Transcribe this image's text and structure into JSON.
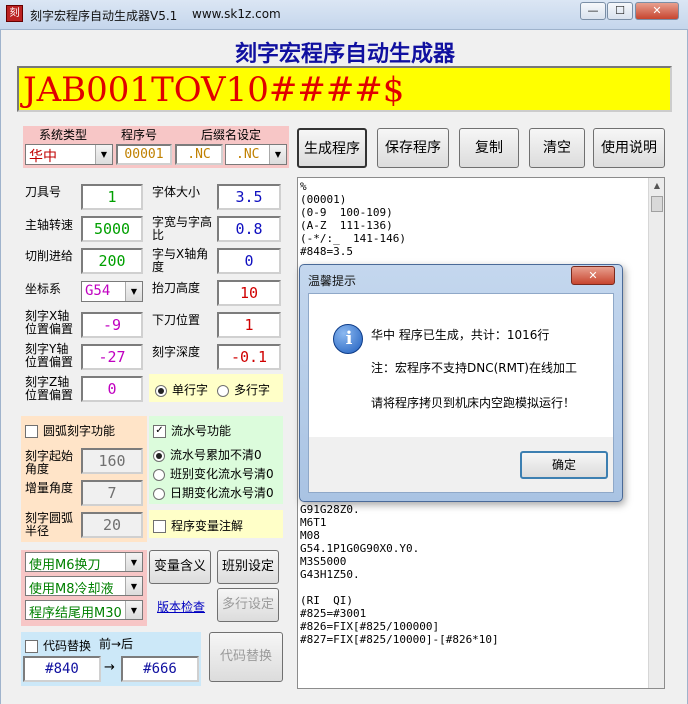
{
  "window": {
    "title": "刻字宏程序自动生成器V5.1",
    "website": "www.sk1z.com",
    "min": "—",
    "max": "☐",
    "close": "✕"
  },
  "header": {
    "title": "刻字宏程序自动生成器",
    "input_text": "JAB001TOV10####$"
  },
  "settings": {
    "system_label": "系统类型",
    "program_no_label": "程序号",
    "suffix_label": "后缀名设定",
    "system_value": "华中",
    "program_no_value": "00001",
    "suffix_value1": ".NC",
    "suffix_value2": ".NC"
  },
  "params": {
    "tool_no_label": "刀具号",
    "tool_no": "1",
    "font_size_label": "字体大小",
    "font_size": "3.5",
    "spindle_label": "主轴转速",
    "spindle": "5000",
    "ratio_label": "字宽与字高比",
    "ratio": "0.8",
    "feed_label": "切削进给",
    "feed": "200",
    "angle_label": "字与X轴角度",
    "angle": "0",
    "coord_label": "坐标系",
    "coord": "G54",
    "lift_label": "抬刀高度",
    "lift": "10",
    "x_offset_label": "刻字X轴位置偏置",
    "x_offset": "-9",
    "down_label": "下刀位置",
    "down": "1",
    "y_offset_label": "刻字Y轴位置偏置",
    "y_offset": "-27",
    "depth_label": "刻字深度",
    "depth": "-0.1",
    "z_offset_label": "刻字Z轴位置偏置",
    "z_offset": "0",
    "single_line": "单行字",
    "multi_line": "多行字"
  },
  "arc": {
    "checkbox_label": "圆弧刻字功能",
    "start_angle_label": "刻字起始角度",
    "start_angle": "160",
    "increment_label": "增量角度",
    "increment": "7",
    "radius_label": "刻字圆弧半径",
    "radius": "20"
  },
  "serial": {
    "checkbox_label": "流水号功能",
    "opt1": "流水号累加不清0",
    "opt2": "班别变化流水号清0",
    "opt3": "日期变化流水号清0",
    "var_annotation": "程序变量注解"
  },
  "combos": {
    "m6": "使用M6换刀",
    "m8": "使用M8冷却液",
    "m30": "程序结尾用M30"
  },
  "buttons": {
    "var_meaning": "变量含义",
    "shift_setting": "班别设定",
    "version_check": "版本检查",
    "multi_setting": "多行设定",
    "generate": "生成程序",
    "save": "保存程序",
    "copy": "复制",
    "clear": "清空",
    "help": "使用说明",
    "code_replace": "代码替换"
  },
  "replace": {
    "checkbox_label": "代码替换",
    "hint": "前→后",
    "from": "#840",
    "to": "#666",
    "arrow": "→"
  },
  "code_lines_top": [
    "%",
    "(00001)",
    "(0-9  100-109)",
    "(A-Z  111-136)",
    "(-*/:_  141-146)",
    "#848=3.5"
  ],
  "code_lines_bottom": [
    "G91G28Z0.",
    "M6T1",
    "M08",
    "G54.1P1G0G90X0.Y0.",
    "M3S5000",
    "G43H1Z50.",
    "",
    "(RI  QI)",
    "#825=#3001",
    "#826=FIX[#825/100000]",
    "#827=FIX[#825/10000]-[#826*10]"
  ],
  "dialog": {
    "title": "温馨提示",
    "close": "✕",
    "line1": "华中 程序已生成，共计：1016行",
    "line2": "注：宏程序不支持DNC(RMT)在线加工",
    "line3": "请将程序拷贝到机床内空跑模拟运行！",
    "ok": "确定",
    "info_glyph": "i"
  },
  "colors": {
    "header_title": "#1010a0",
    "input_bg": "#ffff00",
    "input_text": "#e00000",
    "label_bg": "#f7c6c6",
    "arc_panel": "#ffe4c8",
    "serial_panel": "#dcfcdc",
    "radio_panel": "#ffffc8",
    "replace_panel": "#cce8f8"
  }
}
